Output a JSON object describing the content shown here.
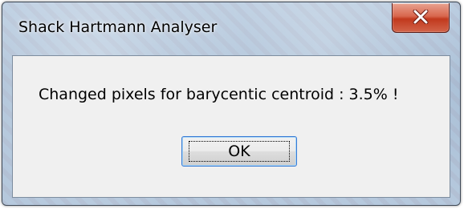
{
  "window": {
    "title": "Shack Hartmann Analyser",
    "close_icon": "close-x-icon"
  },
  "dialog": {
    "message": "Changed pixels for barycentic centroid : 3.5% !",
    "ok_label": "OK"
  },
  "colors": {
    "close_button": "#c1391d",
    "focus_border": "#3a7bd5",
    "client_background": "#f0f0f0"
  }
}
